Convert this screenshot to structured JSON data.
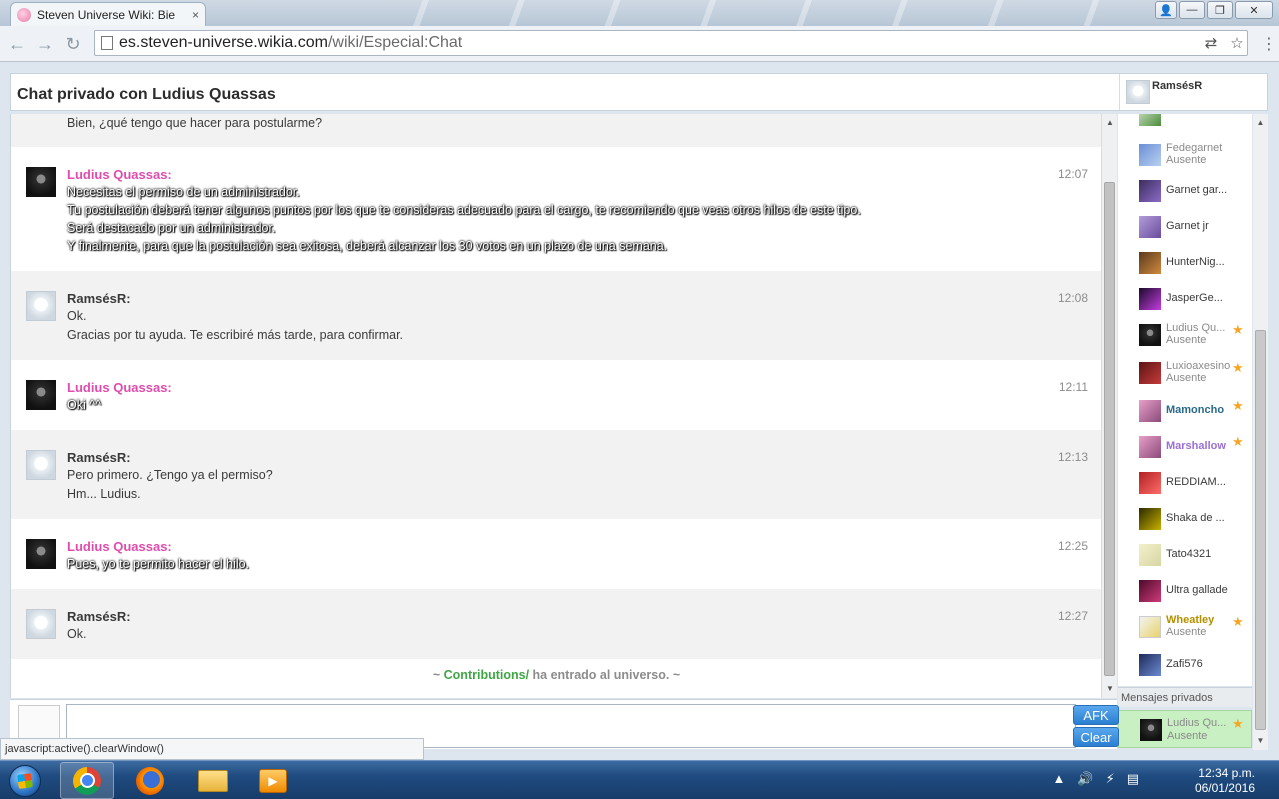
{
  "browser": {
    "tab_title": "Steven Universe Wiki: Bie",
    "tab_close": "×",
    "url_host": "es.steven-universe.wikia.com",
    "url_path": "/wiki/Especial:Chat",
    "status_url": "javascript:active().clearWindow()"
  },
  "chat": {
    "title": "Chat privado con Ludius Quassas",
    "current_user": "RamsésR",
    "messages": [
      {
        "lines": [
          "Bien, ¿qué tengo que hacer para postularme?"
        ]
      },
      {
        "author": "Ludius Quassas:",
        "time": "12:07",
        "lines": [
          "Necesitas el permiso de un administrador.",
          "Tu postulación deberá tener algunos puntos por los que te consideras adecuado para el cargo, te recomiendo que veas otros hilos de este tipo.",
          "Será destacado por un administrador.",
          "Y finalmente, para que la postulación sea exitosa, deberá alcanzar los 30 votos en un plazo de una semana."
        ]
      },
      {
        "author": "RamsésR:",
        "time": "12:08",
        "lines": [
          "Ok.",
          "Gracias por tu ayuda. Te escribiré más tarde, para confirmar."
        ]
      },
      {
        "author": "Ludius Quassas:",
        "time": "12:11",
        "lines": [
          "Oki ^^"
        ]
      },
      {
        "author": "RamsésR:",
        "time": "12:13",
        "lines": [
          "Pero primero. ¿Tengo ya el permiso?",
          "Hm... Ludius."
        ]
      },
      {
        "author": "Ludius Quassas:",
        "time": "12:25",
        "lines": [
          "Pues, yo te permito hacer el hilo."
        ]
      },
      {
        "author": "RamsésR:",
        "time": "12:27",
        "lines": [
          "Ok."
        ]
      }
    ],
    "inline_alert": {
      "prefix": "~ ",
      "user": "Contributions/",
      "text": " ha entrado al universo. ~"
    }
  },
  "userlist": [
    {
      "name": "Fedegarnet",
      "status": "Ausente"
    },
    {
      "name": "Garnet gar...",
      "status": ""
    },
    {
      "name": "Garnet jr",
      "status": ""
    },
    {
      "name": "HunterNig...",
      "status": ""
    },
    {
      "name": "JasperGe...",
      "status": ""
    },
    {
      "name": "Ludius Qu...",
      "status": "Ausente",
      "star": "★"
    },
    {
      "name": "Luxioaxesino",
      "status": "Ausente",
      "star": "★"
    },
    {
      "name": "Mamoncho",
      "status": "",
      "star": "★"
    },
    {
      "name": "Marshallow",
      "status": "",
      "star": "★"
    },
    {
      "name": "REDDIAM...",
      "status": ""
    },
    {
      "name": "Shaka de ...",
      "status": ""
    },
    {
      "name": "Tato4321",
      "status": ""
    },
    {
      "name": "Ultra gallade",
      "status": ""
    },
    {
      "name": "Wheatley",
      "status": "Ausente",
      "star": "★"
    },
    {
      "name": "Zafi576",
      "status": ""
    }
  ],
  "private": {
    "header": "Mensajes privados",
    "item": {
      "name": "Ludius Qu...",
      "status": "Ausente",
      "star": "★"
    }
  },
  "buttons": {
    "afk": "AFK",
    "clear": "Clear"
  },
  "taskbar": {
    "time": "12:34 p.m.",
    "date": "06/01/2016"
  },
  "colors": {
    "moderator_name": "#e04cae",
    "join_user": "#3fa645",
    "button_blue": "#2a7fd1",
    "private_bg": "#c8f0c2"
  }
}
